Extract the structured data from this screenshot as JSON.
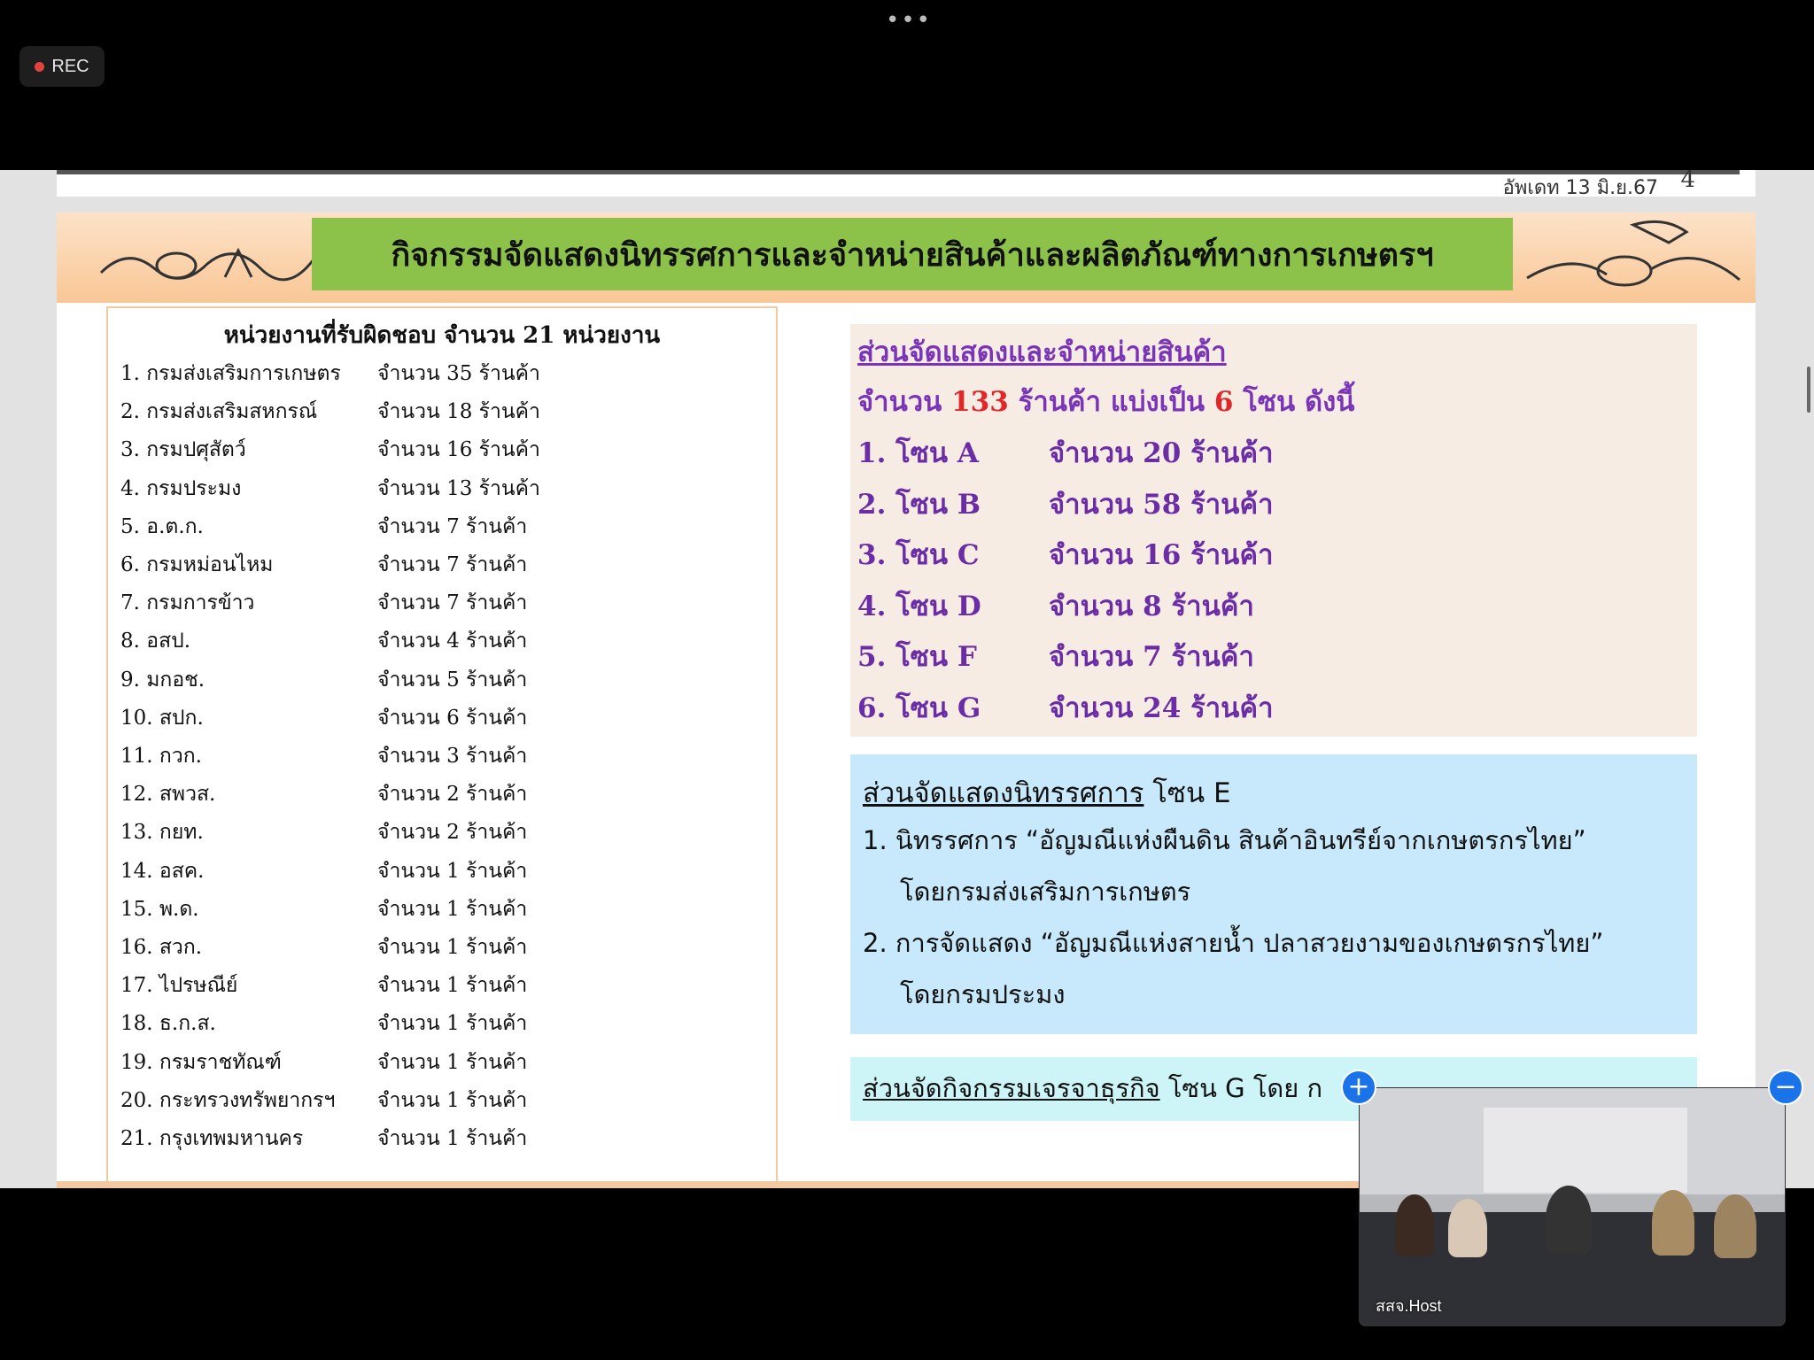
{
  "recording": {
    "label": "REC"
  },
  "slide": {
    "update_text": "อัพเดท 13 มิ.ย.67",
    "page_number": "4",
    "title": "กิจกรรมจัดแสดงนิทรรศการและจำหน่ายสินค้าและผลิตภัณฑ์ทางการเกษตรฯ",
    "agencies": {
      "heading": "หน่วยงานที่รับผิดชอบ จำนวน 21 หน่วยงาน",
      "items": [
        {
          "name": "1. กรมส่งเสริมการเกษตร",
          "count": "จำนวน  35 ร้านค้า"
        },
        {
          "name": "2. กรมส่งเสริมสหกรณ์",
          "count": "จำนวน  18 ร้านค้า"
        },
        {
          "name": "3. กรมปศุสัตว์",
          "count": "จำนวน  16  ร้านค้า"
        },
        {
          "name": "4. กรมประมง",
          "count": "จำนวน  13 ร้านค้า"
        },
        {
          "name": "5. อ.ต.ก.",
          "count": "จำนวน  7  ร้านค้า"
        },
        {
          "name": "6. กรมหม่อนไหม",
          "count": "จำนวน  7  ร้านค้า"
        },
        {
          "name": "7. กรมการข้าว",
          "count": "จำนวน  7  ร้านค้า"
        },
        {
          "name": "8. อสป.",
          "count": "จำนวน   4  ร้านค้า"
        },
        {
          "name": "9. มกอช.",
          "count": "จำนวน   5  ร้านค้า"
        },
        {
          "name": "10. สปก.",
          "count": "จำนวน   6 ร้านค้า"
        },
        {
          "name": "11. กวก.",
          "count": "จำนวน   3  ร้านค้า"
        },
        {
          "name": "12. สพวส.",
          "count": "จำนวน  2  ร้านค้า"
        },
        {
          "name": "13. กยท.",
          "count": "จำนวน  2  ร้านค้า"
        },
        {
          "name": "14. อสค.",
          "count": "จำนวน  1  ร้านค้า"
        },
        {
          "name": "15. พ.ด.",
          "count": "จำนวน  1  ร้านค้า"
        },
        {
          "name": "16. สวก.",
          "count": "จำนวน  1  ร้านค้า"
        },
        {
          "name": "17. ไปรษณีย์",
          "count": "จำนวน  1  ร้านค้า"
        },
        {
          "name": "18. ธ.ก.ส.",
          "count": "จำนวน  1  ร้านค้า"
        },
        {
          "name": "19. กรมราชทัณฑ์",
          "count": "จำนวน  1  ร้านค้า"
        },
        {
          "name": "20. กระทรวงทรัพยากรฯ",
          "count": "จำนวน  1  ร้านค้า"
        },
        {
          "name": "21. กรุงเทพมหานคร",
          "count": "จำนวน  1  ร้านค้า"
        }
      ]
    },
    "zones": {
      "heading": "ส่วนจัดแสดงและจำหน่ายสินค้า",
      "summary_prefix": "จำนวน ",
      "summary_total": "133",
      "summary_mid": " ร้านค้า แบ่งเป็น ",
      "summary_zones": "6",
      "summary_suffix": " โซน ดังนี้",
      "items": [
        {
          "label": "1. โซน A",
          "count": "จำนวน   20  ร้านค้า"
        },
        {
          "label": "2. โซน B",
          "count": "จำนวน   58  ร้านค้า"
        },
        {
          "label": "3. โซน C",
          "count": "จำนวน   16  ร้านค้า"
        },
        {
          "label": "4. โซน D",
          "count": "จำนวน   8   ร้านค้า"
        },
        {
          "label": "5. โซน F",
          "count": "จำนวน    7   ร้านค้า"
        },
        {
          "label": "6. โซน G",
          "count": "จำนวน   24  ร้านค้า"
        }
      ]
    },
    "exhibition": {
      "heading_underlined": "ส่วนจัดแสดงนิทรรศการ",
      "heading_rest": " โซน E",
      "lines": [
        "1. นิทรรศการ “อัญมณีแห่งผืนดิน สินค้าอินทรีย์จากเกษตรกรไทย”",
        "โดยกรมส่งเสริมการเกษตร",
        "2. การจัดแสดง “อัญมณีแห่งสายน้ำ ปลาสวยงามของเกษตรกรไทย”",
        "โดยกรมประมง"
      ]
    },
    "business": {
      "heading_underlined": "ส่วนจัดกิจกรรมเจรจาธุรกิจ",
      "heading_rest": " โซน G โดย ก"
    }
  },
  "video_tile": {
    "participant_name": "สสจ.Host",
    "add_button": "+",
    "minimize_button": "−"
  }
}
